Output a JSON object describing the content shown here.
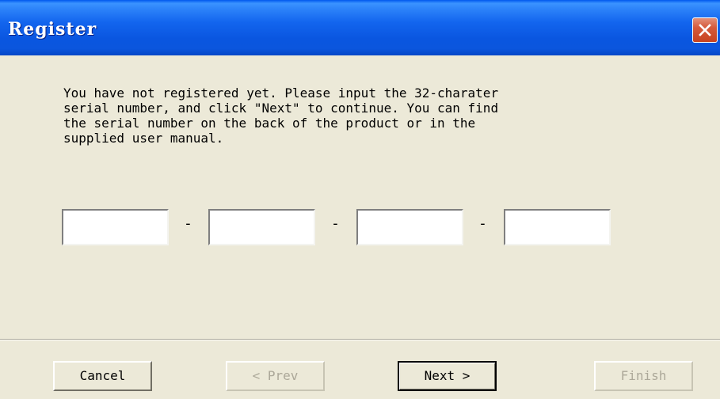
{
  "window": {
    "title": "Register"
  },
  "message": "You have not registered yet. Please input the 32-charater\nserial number, and click \"Next\" to continue. You can find\nthe serial number on the back of the product or in the\nsupplied user manual.",
  "serial": {
    "fields": [
      "",
      "",
      "",
      ""
    ],
    "separator": "-"
  },
  "buttons": {
    "cancel": "Cancel",
    "prev": "< Prev",
    "next": "Next >",
    "finish": "Finish"
  },
  "colors": {
    "dialog_background": "#ECE9D8",
    "titlebar_blue": "#0A56E0",
    "close_red": "#D55A3B",
    "disabled_text": "#ACA899"
  },
  "icons": {
    "close": "close-icon"
  }
}
